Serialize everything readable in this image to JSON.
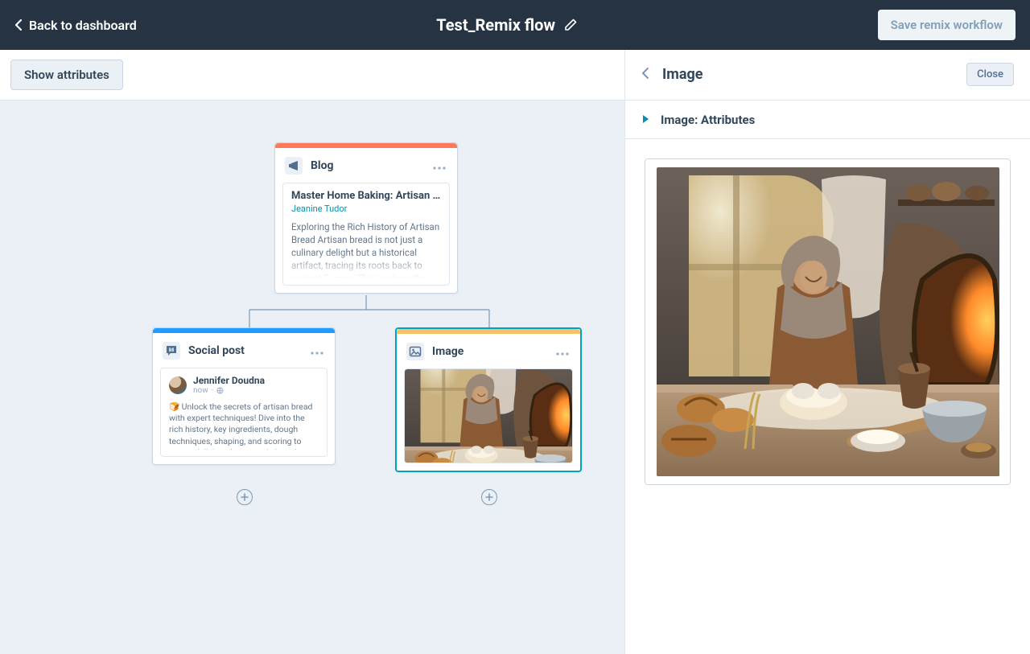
{
  "header": {
    "back_label": "Back to dashboard",
    "title": "Test_Remix flow",
    "save_label": "Save remix workflow"
  },
  "toolbar": {
    "show_attributes_label": "Show attributes"
  },
  "nodes": {
    "blog": {
      "label": "Blog",
      "card_title": "Master Home Baking: Artisan Br...",
      "author": "Jeanine Tudor",
      "excerpt": "Exploring the Rich History of Artisan Bread Artisan bread is not just a culinary delight but a historical artifact, tracing its roots back to ancient Europe. This is where the"
    },
    "social": {
      "label": "Social post",
      "user_name": "Jennifer Doudna",
      "time": "now",
      "body": "🍞 Unlock the secrets of artisan bread with expert techniques! Dive into the rich history, key ingredients, dough techniques, shaping, and scoring to create delicious homemade bread. Bake, enjoy, and savor the satisfaction of your own"
    },
    "image": {
      "label": "Image"
    }
  },
  "sidebar": {
    "title": "Image",
    "section_title": "Image:  Attributes",
    "close_label": "Close"
  }
}
